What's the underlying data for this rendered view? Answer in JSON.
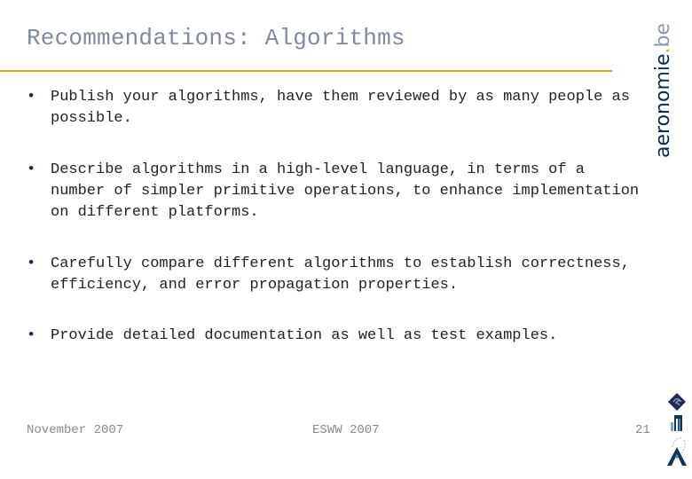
{
  "slide": {
    "title": "Recommendations: Algorithms",
    "brand": {
      "main": "aeronomie",
      "dot": ".",
      "tld": "be"
    },
    "colors": {
      "title": "#7f8a9e",
      "rule": "#d9a726",
      "brand_dark": "#0e2d4a",
      "brand_accent": "#e0a81e"
    },
    "bullets": [
      {
        "text": "Publish your algorithms, have them reviewed by as many people as possible."
      },
      {
        "text": "Describe algorithms in a high-level language, in terms of a number of simpler primitive operations, to enhance implementation on different platforms."
      },
      {
        "text": "Carefully compare different algorithms to establish correctness, efficiency, and error propagation properties."
      },
      {
        "text": "Provide detailed documentation as well as test examples."
      }
    ],
    "bullet_glyph": "•",
    "footer": {
      "date": "November 2007",
      "event": "ESWW 2007",
      "page_number": "21"
    },
    "logos": [
      "institute-diamond-logo",
      "building-logo",
      "antenna-a-logo"
    ]
  }
}
